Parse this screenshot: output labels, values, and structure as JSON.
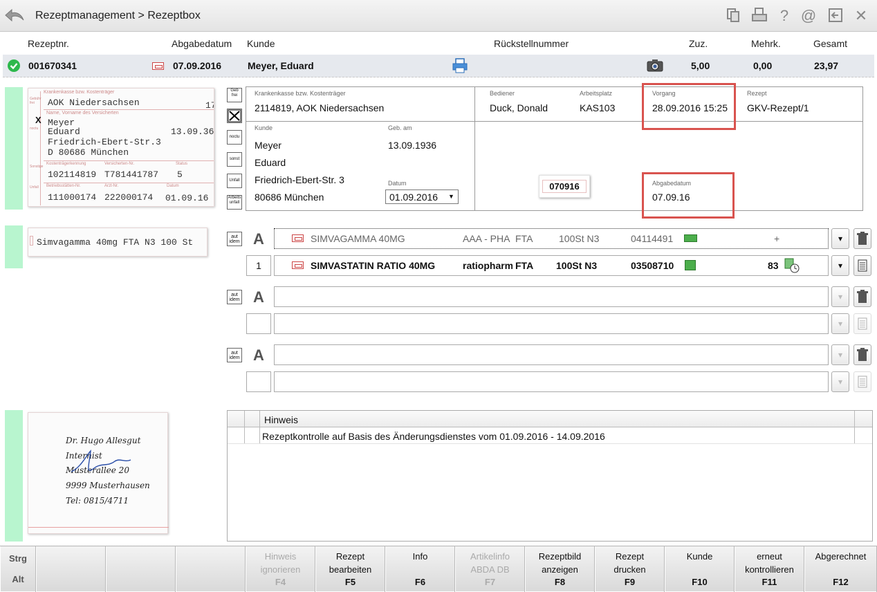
{
  "titlebar": {
    "title": "Rezeptmanagement > Rezeptbox",
    "icons": [
      "copy-icon",
      "print-icon",
      "help-icon",
      "mail-icon",
      "exit-window-icon",
      "close-icon"
    ]
  },
  "header": {
    "columns": [
      "Rezeptnr.",
      "Abgabedatum",
      "Kunde",
      "Rückstellnummer",
      "Zuz.",
      "Mehrk.",
      "Gesamt"
    ],
    "row": {
      "rezeptnr": "001670341",
      "abgabedatum": "07.09.2016",
      "kunde": "Meyer, Eduard",
      "zuz": "5,00",
      "mehrk": "0,00",
      "gesamt": "23,97"
    }
  },
  "scan_top": {
    "krankenkasse_label": "Krankenkasse bzw. Kostenträger",
    "kasse": "AOK Niedersachsen",
    "kasse_nr": "17",
    "name_label": "Name, Vorname des Versicherten",
    "mark": "X",
    "name1": "Meyer",
    "name2": "Eduard",
    "geb": "13.09.36",
    "strasse": "Friedrich-Ebert-Str.3",
    "ort": "D 80686 München",
    "kostentraeger_label": "Kostenträgerkennung",
    "versicherten_label": "Versicherten-Nr.",
    "status_label": "Status",
    "kostentraeger": "102114819",
    "versicherten": "T781441787",
    "status": "5",
    "betrieb_label": "Betriebsstätten-Nr.",
    "arzt_label": "Arzt-Nr.",
    "datum_label": "Datum",
    "betrieb": "111000174",
    "arzt": "222000174",
    "datum": "01.09.16",
    "side_labels": [
      "Gebühr frei",
      "geb.-pfl.",
      "noctu",
      "Sonstige",
      "Unfall"
    ]
  },
  "scan_mid": {
    "text": "Simvagamma 40mg FTA N3 100 St"
  },
  "scan_bottom": {
    "lines": [
      "Dr. Hugo Allesgut",
      "Internist",
      "Musterallee 20",
      "9999 Musterhausen",
      "Tel: 0815/4711"
    ]
  },
  "side_buttons": [
    {
      "label": "Geb frei"
    },
    {
      "label": ""
    },
    {
      "label": "noctu"
    },
    {
      "label": "sonst"
    },
    {
      "label": "Unfall"
    },
    {
      "label": "Arbeits unfall"
    }
  ],
  "databox": {
    "krankenkasse_label": "Krankenkasse bzw. Kostenträger",
    "krankenkasse": "2114819, AOK Niedersachsen",
    "bediener_label": "Bediener",
    "bediener": "Duck, Donald",
    "arbeitsplatz_label": "Arbeitsplatz",
    "arbeitsplatz": "KAS103",
    "vorgang_label": "Vorgang",
    "vorgang": "28.09.2016 15:25",
    "rezept_label": "Rezept",
    "rezept": "GKV-Rezept/1",
    "kunde_label": "Kunde",
    "kunde_name1": "Meyer",
    "kunde_name2": "Eduard",
    "kunde_strasse": "Friedrich-Ebert-Str. 3",
    "kunde_ort": "80686 München",
    "geb_label": "Geb. am",
    "geb": "13.09.1936",
    "datum_label": "Datum",
    "datum": "01.09.2016",
    "stamp": "070916",
    "abgabedatum_label": "Abgabedatum",
    "abgabedatum": "07.09.16"
  },
  "articles": [
    {
      "aut_idem": "aut idem",
      "a": "A",
      "name": "SIMVAGAMMA 40MG",
      "hersteller": "AAA - PHA",
      "form": "FTA",
      "menge": "100St N3",
      "pzn": "04114491",
      "status": "+",
      "qty": "1",
      "name2": "SIMVASTATIN RATIO 40MG",
      "hersteller2": "ratiopharm",
      "form2": "FTA",
      "menge2": "100St N3",
      "pzn2": "03508710",
      "count2": "83"
    },
    {
      "aut_idem": "aut idem",
      "a": "A"
    },
    {
      "aut_idem": "aut idem",
      "a": "A"
    }
  ],
  "hint": {
    "header": "Hinweis",
    "rows": [
      "Rezeptkontrolle auf Basis des Änderungsdienstes vom 01.09.2016 - 14.09.2016"
    ]
  },
  "fkeys": {
    "mod1": "Strg",
    "mod2": "Alt",
    "keys": [
      {
        "label1": "Hinweis",
        "label2": "ignorieren",
        "key": "F4",
        "enabled": false
      },
      {
        "label1": "Rezept",
        "label2": "bearbeiten",
        "key": "F5",
        "enabled": true
      },
      {
        "label1": "Info",
        "label2": "",
        "key": "F6",
        "enabled": true
      },
      {
        "label1": "Artikelinfo",
        "label2": "ABDA DB",
        "key": "F7",
        "enabled": false
      },
      {
        "label1": "Rezeptbild",
        "label2": "anzeigen",
        "key": "F8",
        "enabled": true
      },
      {
        "label1": "Rezept",
        "label2": "drucken",
        "key": "F9",
        "enabled": true
      },
      {
        "label1": "Kunde",
        "label2": "",
        "key": "F10",
        "enabled": true
      },
      {
        "label1": "erneut",
        "label2": "kontrollieren",
        "key": "F11",
        "enabled": true
      },
      {
        "label1": "Abgerechnet",
        "label2": "",
        "key": "F12",
        "enabled": true
      }
    ]
  },
  "colors": {
    "accent_red": "#d9534f",
    "ok_green": "#2db84c",
    "strip_green": "#b8f5cf"
  }
}
